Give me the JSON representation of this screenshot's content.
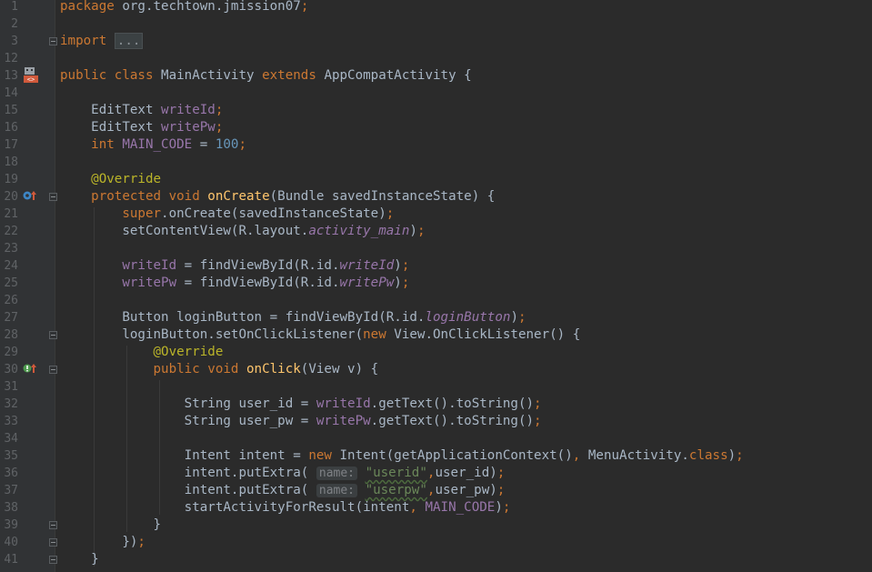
{
  "editor": {
    "lines": [
      {
        "num": "1",
        "tokens": [
          {
            "c": "kw",
            "t": "package "
          },
          {
            "c": "",
            "t": "org.techtown.jmission07"
          },
          {
            "c": "kw",
            "t": ";"
          }
        ]
      },
      {
        "num": "2",
        "tokens": []
      },
      {
        "num": "3",
        "tokens": [
          {
            "c": "kw",
            "t": "import "
          },
          {
            "c": "fold",
            "t": "..."
          }
        ]
      },
      {
        "num": "12",
        "tokens": []
      },
      {
        "num": "13",
        "tokens": [
          {
            "c": "kw",
            "t": "public class "
          },
          {
            "c": "",
            "t": "MainActivity "
          },
          {
            "c": "kw",
            "t": "extends "
          },
          {
            "c": "",
            "t": "AppCompatActivity {"
          }
        ]
      },
      {
        "num": "14",
        "tokens": []
      },
      {
        "num": "15",
        "tokens": [
          {
            "c": "",
            "t": "    EditText "
          },
          {
            "c": "fld",
            "t": "writeId"
          },
          {
            "c": "kw",
            "t": ";"
          }
        ]
      },
      {
        "num": "16",
        "tokens": [
          {
            "c": "",
            "t": "    EditText "
          },
          {
            "c": "fld",
            "t": "writePw"
          },
          {
            "c": "kw",
            "t": ";"
          }
        ]
      },
      {
        "num": "17",
        "tokens": [
          {
            "c": "kw",
            "t": "    int "
          },
          {
            "c": "fld",
            "t": "MAIN_CODE"
          },
          {
            "c": "",
            "t": " = "
          },
          {
            "c": "num",
            "t": "100"
          },
          {
            "c": "kw",
            "t": ";"
          }
        ]
      },
      {
        "num": "18",
        "tokens": []
      },
      {
        "num": "19",
        "tokens": [
          {
            "c": "ann",
            "t": "    @Override"
          }
        ]
      },
      {
        "num": "20",
        "tokens": [
          {
            "c": "kw",
            "t": "    protected void "
          },
          {
            "c": "fn",
            "t": "onCreate"
          },
          {
            "c": "",
            "t": "(Bundle savedInstanceState) {"
          }
        ]
      },
      {
        "num": "21",
        "tokens": [
          {
            "c": "kw",
            "t": "        super"
          },
          {
            "c": "",
            "t": ".onCreate(savedInstanceState)"
          },
          {
            "c": "kw",
            "t": ";"
          }
        ]
      },
      {
        "num": "22",
        "tokens": [
          {
            "c": "",
            "t": "        setContentView(R.layout."
          },
          {
            "c": "fldi",
            "t": "activity_main"
          },
          {
            "c": "",
            "t": ")"
          },
          {
            "c": "kw",
            "t": ";"
          }
        ]
      },
      {
        "num": "23",
        "tokens": []
      },
      {
        "num": "24",
        "tokens": [
          {
            "c": "fld",
            "t": "        writeId"
          },
          {
            "c": "",
            "t": " = findViewById(R.id."
          },
          {
            "c": "fldi",
            "t": "writeId"
          },
          {
            "c": "",
            "t": ")"
          },
          {
            "c": "kw",
            "t": ";"
          }
        ]
      },
      {
        "num": "25",
        "tokens": [
          {
            "c": "fld",
            "t": "        writePw"
          },
          {
            "c": "",
            "t": " = findViewById(R.id."
          },
          {
            "c": "fldi",
            "t": "writePw"
          },
          {
            "c": "",
            "t": ")"
          },
          {
            "c": "kw",
            "t": ";"
          }
        ]
      },
      {
        "num": "26",
        "tokens": []
      },
      {
        "num": "27",
        "tokens": [
          {
            "c": "",
            "t": "        Button loginButton = findViewById(R.id."
          },
          {
            "c": "fldi",
            "t": "loginButton"
          },
          {
            "c": "",
            "t": ")"
          },
          {
            "c": "kw",
            "t": ";"
          }
        ]
      },
      {
        "num": "28",
        "tokens": [
          {
            "c": "",
            "t": "        loginButton.setOnClickListener("
          },
          {
            "c": "kw",
            "t": "new "
          },
          {
            "c": "",
            "t": "View.OnClickListener() {"
          }
        ]
      },
      {
        "num": "29",
        "tokens": [
          {
            "c": "ann",
            "t": "            @Override"
          }
        ]
      },
      {
        "num": "30",
        "tokens": [
          {
            "c": "kw",
            "t": "            public void "
          },
          {
            "c": "fn",
            "t": "onClick"
          },
          {
            "c": "",
            "t": "(View v) {"
          }
        ]
      },
      {
        "num": "31",
        "tokens": []
      },
      {
        "num": "32",
        "tokens": [
          {
            "c": "",
            "t": "                String user_id = "
          },
          {
            "c": "fld",
            "t": "writeId"
          },
          {
            "c": "",
            "t": ".getText().toString()"
          },
          {
            "c": "kw",
            "t": ";"
          }
        ]
      },
      {
        "num": "33",
        "tokens": [
          {
            "c": "",
            "t": "                String user_pw = "
          },
          {
            "c": "fld",
            "t": "writePw"
          },
          {
            "c": "",
            "t": ".getText().toString()"
          },
          {
            "c": "kw",
            "t": ";"
          }
        ]
      },
      {
        "num": "34",
        "tokens": []
      },
      {
        "num": "35",
        "tokens": [
          {
            "c": "",
            "t": "                Intent intent = "
          },
          {
            "c": "kw",
            "t": "new "
          },
          {
            "c": "",
            "t": "Intent(getApplicationContext()"
          },
          {
            "c": "kw",
            "t": ", "
          },
          {
            "c": "",
            "t": "MenuActivity."
          },
          {
            "c": "kw",
            "t": "class"
          },
          {
            "c": "",
            "t": ")"
          },
          {
            "c": "kw",
            "t": ";"
          }
        ]
      },
      {
        "num": "36",
        "tokens": [
          {
            "c": "",
            "t": "                intent.putExtra( "
          },
          {
            "c": "hint",
            "t": "name:"
          },
          {
            "c": "",
            "t": " "
          },
          {
            "c": "str",
            "t": "\"userid\""
          },
          {
            "c": "kw",
            "t": ","
          },
          {
            "c": "",
            "t": "user_id)"
          },
          {
            "c": "kw",
            "t": ";"
          }
        ]
      },
      {
        "num": "37",
        "tokens": [
          {
            "c": "",
            "t": "                intent.putExtra( "
          },
          {
            "c": "hint",
            "t": "name:"
          },
          {
            "c": "",
            "t": " "
          },
          {
            "c": "str",
            "t": "\"userpw\""
          },
          {
            "c": "kw",
            "t": ","
          },
          {
            "c": "",
            "t": "user_pw)"
          },
          {
            "c": "kw",
            "t": ";"
          }
        ]
      },
      {
        "num": "38",
        "tokens": [
          {
            "c": "",
            "t": "                startActivityForResult(intent"
          },
          {
            "c": "kw",
            "t": ", "
          },
          {
            "c": "fld",
            "t": "MAIN_CODE"
          },
          {
            "c": "",
            "t": ")"
          },
          {
            "c": "kw",
            "t": ";"
          }
        ]
      },
      {
        "num": "39",
        "tokens": [
          {
            "c": "",
            "t": "            }"
          }
        ]
      },
      {
        "num": "40",
        "tokens": [
          {
            "c": "",
            "t": "        })"
          },
          {
            "c": "kw",
            "t": ";"
          }
        ]
      },
      {
        "num": "41",
        "tokens": [
          {
            "c": "",
            "t": "    }"
          }
        ]
      }
    ],
    "gutter_icons": {
      "line13": "android-activity-icon",
      "line20": "override-method-icon",
      "line30": "implement-method-icon"
    },
    "colors": {
      "background": "#2b2b2b",
      "gutter": "#313335",
      "keyword": "#cc7832",
      "field": "#9876aa",
      "number": "#6897bb",
      "annotation": "#bbb529",
      "method": "#ffc66d",
      "string": "#6a8759",
      "text": "#a9b7c6"
    }
  }
}
